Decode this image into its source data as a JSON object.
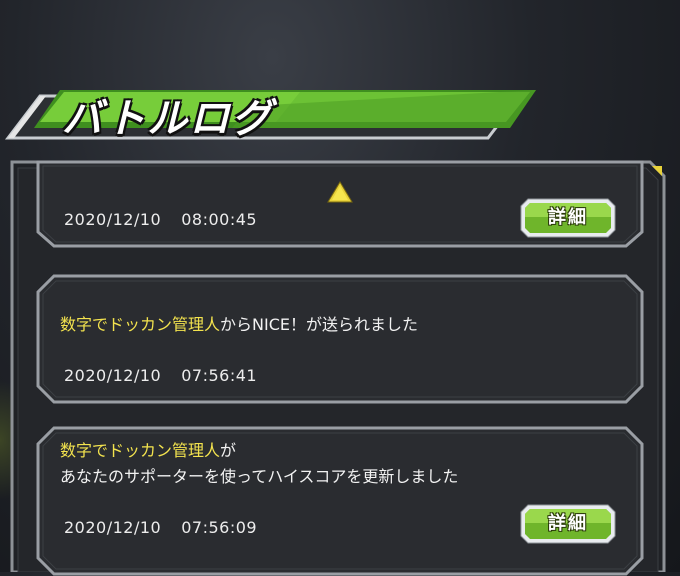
{
  "header": {
    "title": "バトルログ"
  },
  "entries": [
    {
      "highlight": "",
      "message_line1_rest": "",
      "message_line2": "",
      "date": "2020/12/10",
      "time": "08:00:45",
      "detail_label": "詳細"
    },
    {
      "highlight": "数字でドッカン管理人",
      "message_line1_rest": "からNICE！が送られました",
      "message_line2": "",
      "date": "2020/12/10",
      "time": "07:56:41",
      "detail_label": ""
    },
    {
      "highlight": "数字でドッカン管理人",
      "message_line1_rest": "が",
      "message_line2": "あなたのサポーターを使ってハイスコアを更新しました",
      "date": "2020/12/10",
      "time": "07:56:09",
      "detail_label": "詳細"
    }
  ],
  "colors": {
    "accent_green": "#5fae2a",
    "highlight_yellow": "#f3e34e",
    "frame_gray": "#9a9ea4"
  },
  "icons": {
    "scroll_up": "up-triangle-icon"
  }
}
